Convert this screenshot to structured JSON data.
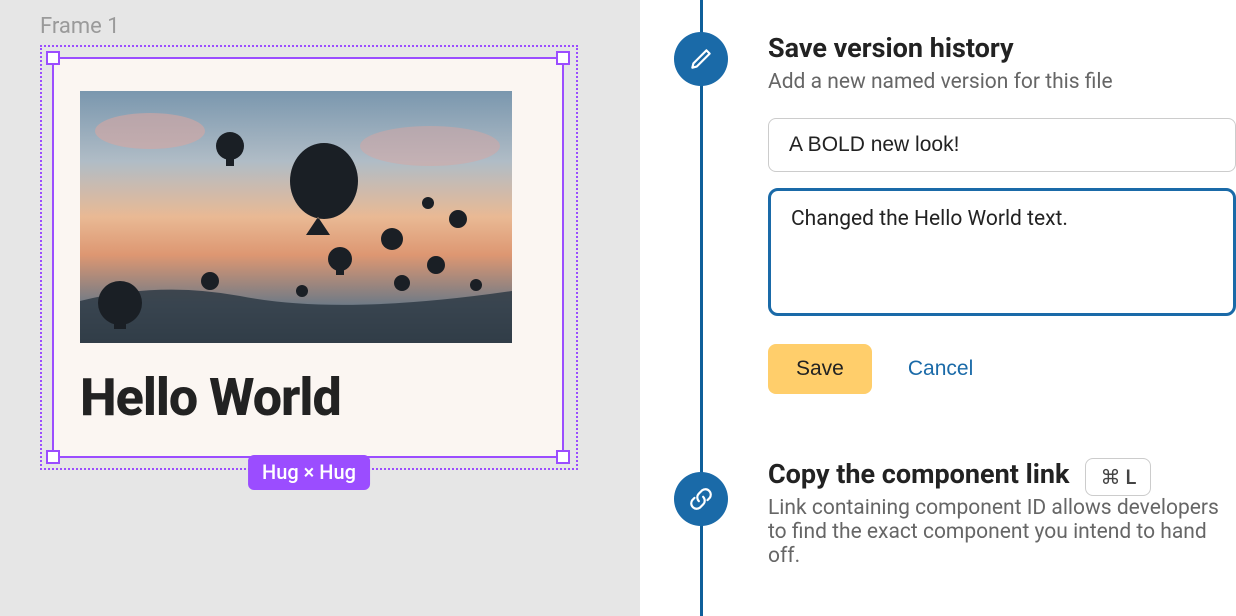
{
  "canvas": {
    "frameLabel": "Frame 1",
    "cardText": "Hello World",
    "resizeBadge": "Hug × Hug"
  },
  "saveSection": {
    "title": "Save version history",
    "subtitle": "Add a new named version for this file",
    "nameInput": "A BOLD new look!",
    "descInput": "Changed the Hello World text.",
    "saveLabel": "Save",
    "cancelLabel": "Cancel"
  },
  "linkSection": {
    "title": "Copy the component link",
    "shortcut": "⌘ L",
    "subtitle": "Link containing component ID allows developers to find the exact component you intend to hand off."
  }
}
